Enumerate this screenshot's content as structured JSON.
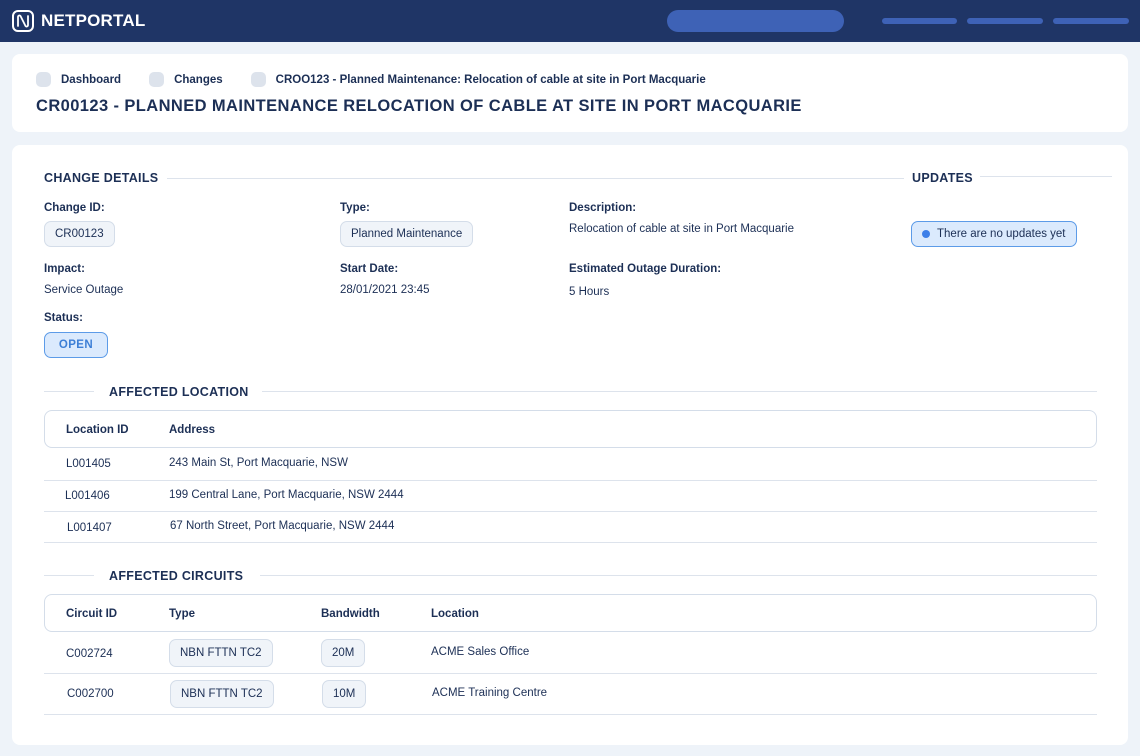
{
  "app": {
    "name": "NETPORTAL"
  },
  "breadcrumb": [
    {
      "label": "Dashboard"
    },
    {
      "label": "Changes"
    },
    {
      "label": "CROO123 - Planned Maintenance: Relocation of cable at site in Port Macquarie"
    }
  ],
  "page": {
    "title": "CR00123 - PLANNED MAINTENANCE RELOCATION OF CABLE AT SITE IN PORT MACQUARIE"
  },
  "change_details": {
    "section_title": "CHANGE DETAILS",
    "change_id_label": "Change ID:",
    "change_id": "CR00123",
    "type_label": "Type:",
    "type": "Planned Maintenance",
    "description_label": "Description:",
    "description": "Relocation of cable at site in Port Macquarie",
    "impact_label": "Impact:",
    "impact": "Service Outage",
    "start_date_label": "Start Date:",
    "start_date": "28/01/2021 23:45",
    "duration_label": "Estimated Outage Duration:",
    "duration": "5 Hours",
    "status_label": "Status:",
    "status": "OPEN"
  },
  "updates": {
    "section_title": "UPDATES",
    "message": "There are no updates yet"
  },
  "affected_location": {
    "section_title": "AFFECTED LOCATION",
    "columns": [
      "Location ID",
      "Address"
    ],
    "rows": [
      {
        "id": "L001405",
        "address": "243 Main St, Port Macquarie, NSW"
      },
      {
        "id": "L001406",
        "address": "199 Central Lane, Port Macquarie, NSW  2444"
      },
      {
        "id": "L001407",
        "address": "67 North Street, Port Macquarie, NSW 2444"
      }
    ]
  },
  "affected_circuits": {
    "section_title": "AFFECTED CIRCUITS",
    "columns": [
      "Circuit ID",
      "Type",
      "Bandwidth",
      "Location"
    ],
    "rows": [
      {
        "id": "C002724",
        "type": "NBN FTTN TC2",
        "bandwidth": "20M",
        "location": "ACME Sales Office"
      },
      {
        "id": "C002700",
        "type": "NBN FTTN TC2",
        "bandwidth": "10M",
        "location": "ACME Training Centre"
      }
    ]
  },
  "colors": {
    "topbar": "#1f3566",
    "accent": "#3d7fe8",
    "text": "#1c2f55"
  }
}
